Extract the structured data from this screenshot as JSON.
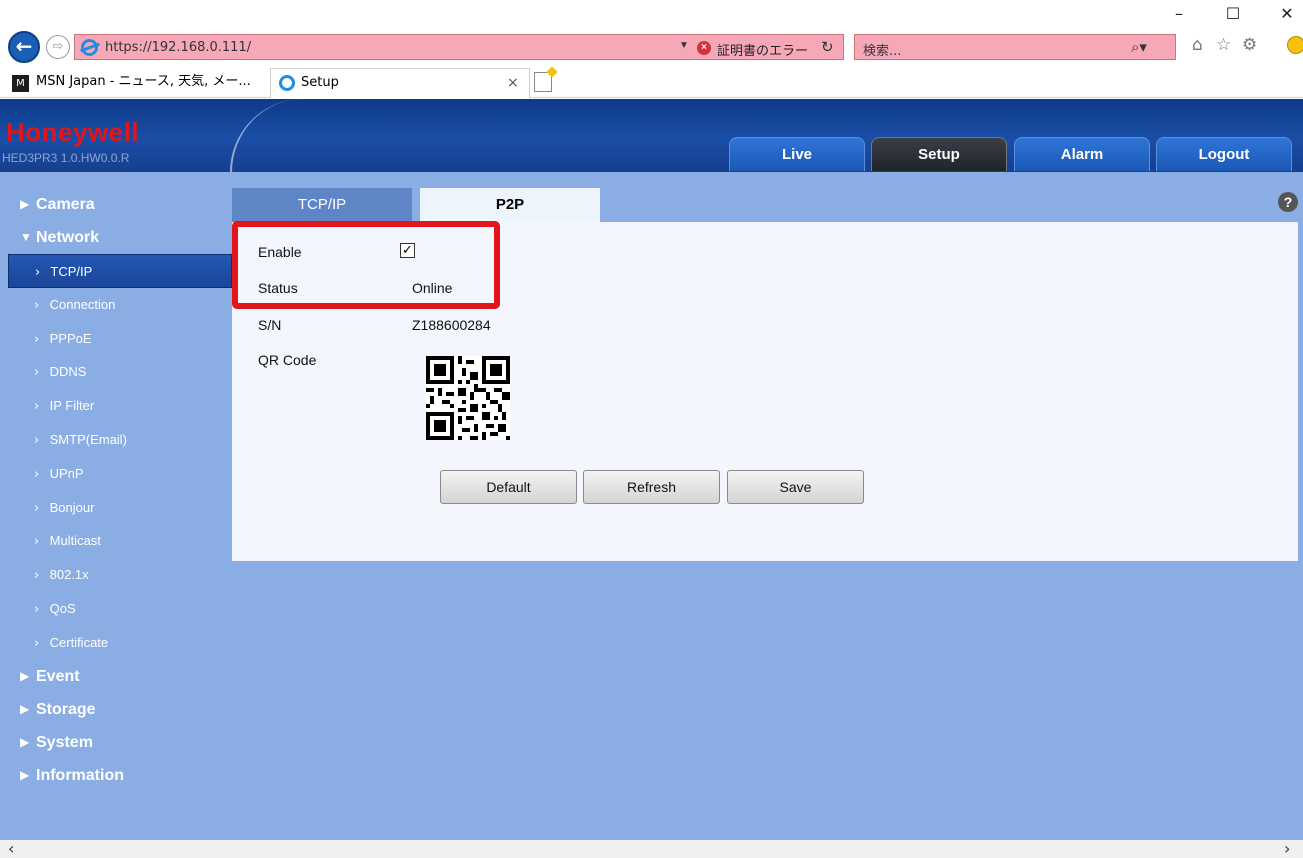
{
  "browser": {
    "window_controls": {
      "minimize": "–",
      "maximize": "☐",
      "close": "✕"
    },
    "url": "https://192.168.0.111/",
    "cert_error": "証明書のエラー",
    "search_placeholder": "検索...",
    "tabs": [
      {
        "label": "MSN Japan - ニュース, 天気, メー..."
      },
      {
        "label": "Setup",
        "close": "×"
      }
    ]
  },
  "app": {
    "logo": "Honeywell",
    "firmware": "HED3PR3  1.0.HW0.0.R",
    "nav": [
      "Live",
      "Setup",
      "Alarm",
      "Logout"
    ],
    "active_nav": "Setup"
  },
  "sidebar": {
    "categories": [
      "Camera",
      "Network",
      "Event",
      "Storage",
      "System",
      "Information"
    ],
    "network_items": [
      "TCP/IP",
      "Connection",
      "PPPoE",
      "DDNS",
      "IP Filter",
      "SMTP(Email)",
      "UPnP",
      "Bonjour",
      "Multicast",
      "802.1x",
      "QoS",
      "Certificate"
    ],
    "selected": "TCP/IP"
  },
  "content": {
    "tabs": [
      "TCP/IP",
      "P2P"
    ],
    "active_tab": "P2P",
    "help": "?",
    "fields": {
      "enable_label": "Enable",
      "enable_checked": true,
      "status_label": "Status",
      "status_value": "Online",
      "sn_label": "S/N",
      "sn_value": "Z188600284",
      "qr_label": "QR Code"
    },
    "buttons": [
      "Default",
      "Refresh",
      "Save"
    ]
  },
  "colors": {
    "highlight": "#e0161b",
    "header_blue": "#1a4ea6",
    "page_bg": "#8aaee3",
    "logo_red": "#e3141b"
  }
}
